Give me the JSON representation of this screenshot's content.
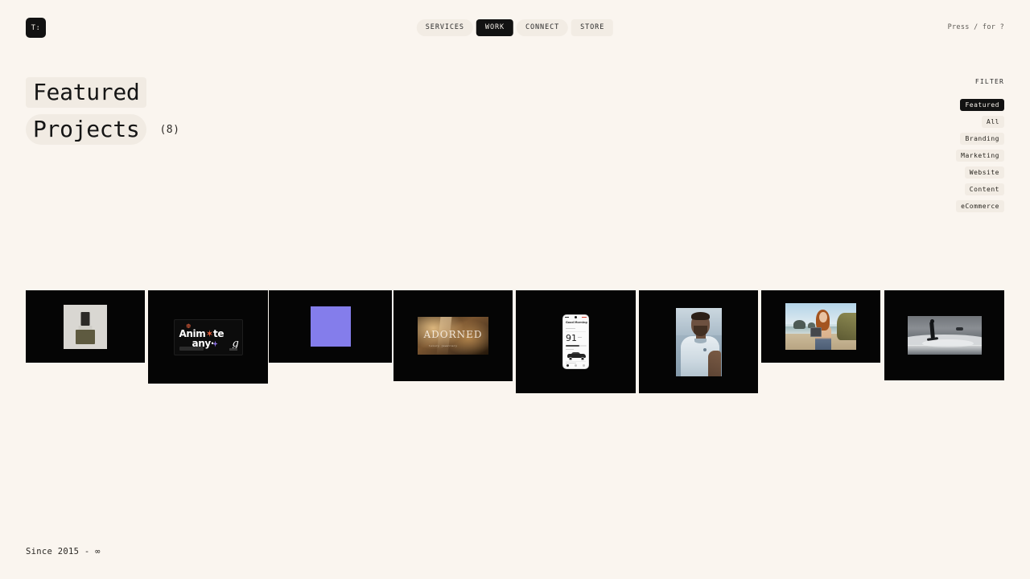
{
  "brand": {
    "logo_text": "T:"
  },
  "header": {
    "nav": [
      {
        "label": "SERVICES",
        "active": false
      },
      {
        "label": "WORK",
        "active": true
      },
      {
        "label": "CONNECT",
        "active": false
      },
      {
        "label": "STORE",
        "active": false
      }
    ],
    "shortcut_hint": "Press / for ?"
  },
  "page": {
    "title_line1": "Featured",
    "title_line2": "Projects",
    "count": "(8)"
  },
  "filter": {
    "heading": "FILTER",
    "items": [
      {
        "label": "Featured",
        "active": true
      },
      {
        "label": "All",
        "active": false
      },
      {
        "label": "Branding",
        "active": false
      },
      {
        "label": "Marketing",
        "active": false
      },
      {
        "label": "Website",
        "active": false
      },
      {
        "label": "Content",
        "active": false
      },
      {
        "label": "eCommerce",
        "active": false
      }
    ]
  },
  "gallery": {
    "cards": [
      {
        "id": "project-perfume-bottle",
        "media": "product-photo"
      },
      {
        "id": "project-animate-anything",
        "media": "motion-graphics"
      },
      {
        "id": "project-purple-block",
        "media": "color-block"
      },
      {
        "id": "project-adorned",
        "media": "editorial-photo"
      },
      {
        "id": "project-mobile-app",
        "media": "app-mockup"
      },
      {
        "id": "project-athlete-portrait",
        "media": "portrait-photo"
      },
      {
        "id": "project-beach-lifestyle",
        "media": "lifestyle-photo"
      },
      {
        "id": "project-surfer",
        "media": "action-photo"
      }
    ],
    "animate_card": {
      "line1_pre": "Anim",
      "line1_dot": "✶",
      "line1_post": "te",
      "line2_pre": "any",
      "line2_post": "·",
      "line2_italic": "g"
    },
    "adorned_card": {
      "word": "ADORNED",
      "subtitle": "luxury jewellery"
    },
    "phone_card": {
      "greeting": "Good\nMorning",
      "score": "91"
    }
  },
  "footer": {
    "text": "Since 2015 - ∞"
  },
  "colors": {
    "background": "#faf5ef",
    "ink": "#121212",
    "chip": "#f2ece4",
    "accent_purple": "#847deb",
    "card_black": "#050505"
  }
}
